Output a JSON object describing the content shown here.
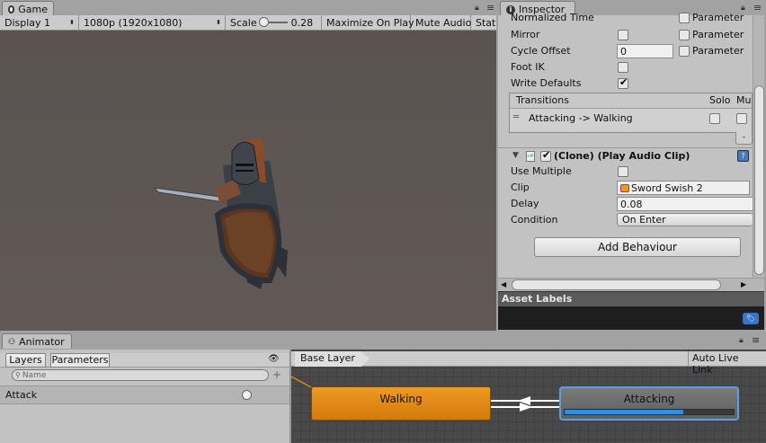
{
  "game": {
    "tab_label": "Game",
    "display": "Display 1",
    "resolution": "1080p (1920x1080)",
    "scale_label": "Scale",
    "scale_value": "0.28",
    "maximize": "Maximize On Play",
    "mute": "Mute Audio",
    "stats": "Stat"
  },
  "inspector": {
    "tab_label": "Inspector",
    "normalized_time": "Normalized Time",
    "parameter_label": "Parameter",
    "mirror": "Mirror",
    "cycle_offset": "Cycle Offset",
    "cycle_offset_value": "0",
    "foot_ik": "Foot IK",
    "write_defaults": "Write Defaults",
    "mirror_checked": false,
    "foot_ik_checked": false,
    "write_defaults_checked": true,
    "transitions": {
      "header": "Transitions",
      "solo": "Solo",
      "mute": "Mu",
      "items": [
        {
          "label": "Attacking -> Walking"
        }
      ]
    },
    "behaviour": {
      "title": "(Clone) (Play Audio Clip)",
      "use_multiple": "Use Multiple",
      "clip_label": "Clip",
      "clip_value": "Sword Swish 2",
      "delay_label": "Delay",
      "delay_value": "0.08",
      "condition_label": "Condition",
      "condition_value": "On Enter"
    },
    "add_behaviour": "Add Behaviour",
    "asset_labels": "Asset Labels"
  },
  "animator": {
    "tab_label": "Animator",
    "layers_tab": "Layers",
    "parameters_tab": "Parameters",
    "search_placeholder": "Name",
    "parameters": [
      {
        "name": "Attack"
      }
    ],
    "breadcrumb": "Base Layer",
    "auto_live_link": "Auto Live Link",
    "states": {
      "walking": "Walking",
      "attacking": "Attacking",
      "attacking_progress": 0.7
    }
  },
  "colors": {
    "game_bg": "#5d5450",
    "walking_state": "#e08a16",
    "attacking_state": "#6b6b6b",
    "selection": "#3c7fd1",
    "progress": "#2f8fe0"
  }
}
